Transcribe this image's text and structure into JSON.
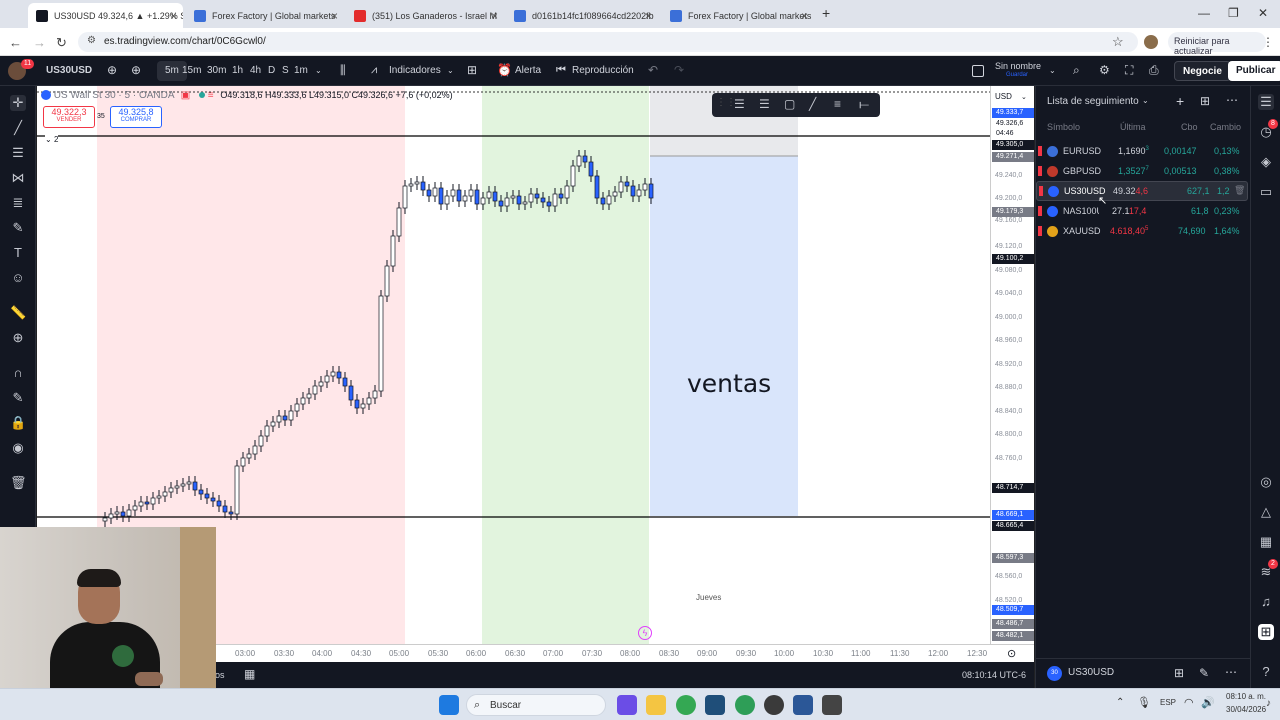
{
  "browser": {
    "tabs": [
      {
        "title": "US30USD 49.324,6 ▲ +1.29% S",
        "active": true,
        "fav_color": "#131722"
      },
      {
        "title": "Forex Factory | Global markets",
        "active": false,
        "fav_color": "#3b6fd8"
      },
      {
        "title": "(351) Los Ganaderos - Israel M",
        "active": false,
        "fav_color": "#e32c2c"
      },
      {
        "title": "d0161b14fc1f089664cd2202fb",
        "active": false,
        "fav_color": "#3b6fd8"
      },
      {
        "title": "Forex Factory | Global markets",
        "active": false,
        "fav_color": "#3b6fd8"
      }
    ],
    "new_tab": "+",
    "url": "es.tradingview.com/chart/0C6Gcwl0/",
    "update_label": "Reiniciar para actualizar"
  },
  "toolbar": {
    "notif_count": "11",
    "symbol": "US30USD",
    "timeframes": [
      "5m",
      "15m",
      "30m",
      "1h",
      "4h",
      "D",
      "S",
      "1m"
    ],
    "indicators_label": "Indicadores",
    "alert_label": "Alerta",
    "replay_label": "Reproducción",
    "layout_name": "Sin nombre",
    "layout_sub": "Guardar",
    "trade_label": "Negocie",
    "publish_label": "Publicar"
  },
  "legend": {
    "symbol_title": "US Wall St 30 · 5 · OANDA",
    "ohlc": "O49.318,6 H49.333,6 L49.315,0 C49.326,6 +7,6 (+0,02%)",
    "sell_price": "49.322,3",
    "sell_label": "VENDER",
    "spread": "35",
    "buy_price": "49.325,8",
    "buy_label": "COMPRAR",
    "indicator_count": "2"
  },
  "chart_annotations": {
    "zone_label": "ventas",
    "day_label": "Jueves"
  },
  "price_axis": {
    "currency": "USD",
    "ticks": [
      "49.240,0",
      "49.200,0",
      "49.160,0",
      "49.120,0",
      "49.080,0",
      "49.040,0",
      "49.000,0",
      "48.960,0",
      "48.920,0",
      "48.880,0",
      "48.840,0",
      "48.800,0",
      "48.760,0",
      "48.560,0",
      "48.520,0"
    ],
    "tags": [
      {
        "text": "49.333,7",
        "color": "#2962ff"
      },
      {
        "text": "49.326,6",
        "color": "#ffffff"
      },
      {
        "text": "04:46",
        "color": "#ffffff"
      },
      {
        "text": "49.305,0",
        "color": "#131722"
      },
      {
        "text": "49.271,4",
        "color": "#787b86"
      },
      {
        "text": "49.179,3",
        "color": "#787b86"
      },
      {
        "text": "49.100,2",
        "color": "#131722"
      },
      {
        "text": "48.714,7",
        "color": "#131722"
      },
      {
        "text": "48.669,1",
        "color": "#2962ff"
      },
      {
        "text": "48.665,4",
        "color": "#131722"
      },
      {
        "text": "48.597,3",
        "color": "#787b86"
      },
      {
        "text": "48.509,7",
        "color": "#2962ff"
      },
      {
        "text": "48.486,7",
        "color": "#787b86"
      },
      {
        "text": "48.482,1",
        "color": "#787b86"
      }
    ]
  },
  "time_axis": {
    "labels": [
      "03:00",
      "03:30",
      "04:00",
      "04:30",
      "05:00",
      "05:30",
      "06:00",
      "06:30",
      "07:00",
      "07:30",
      "08:00",
      "08:30",
      "09:00",
      "09:30",
      "10:00",
      "10:30",
      "11:00",
      "11:30",
      "12:00",
      "12:30"
    ]
  },
  "bottom_bar": {
    "clock": "08:10:14 UTC-6",
    "partial_label": "los"
  },
  "watchlist": {
    "title": "Lista de seguimiento",
    "headers": {
      "symbol": "Símbolo",
      "last": "Última",
      "chg": "Cbo",
      "chgpct": "Cambio"
    },
    "rows": [
      {
        "symbol": "EURUSD",
        "last": "1,1690",
        "last_tail": "3",
        "chg": "0,00147",
        "pct": "0,13%",
        "color": "#26a69a",
        "logo": "#3b6fd8"
      },
      {
        "symbol": "GBPUSD",
        "last": "1,3527",
        "last_tail": "7",
        "chg": "0,00513",
        "pct": "0,38%",
        "color": "#26a69a",
        "logo": "#c0392b"
      },
      {
        "symbol": "US30USD",
        "last": "49.32",
        "last_tail": "4,6",
        "chg": "627,1",
        "pct": "1,2",
        "color": "#26a69a",
        "logo": "#2962ff"
      },
      {
        "symbol": "NAS100USD",
        "last": "27.1",
        "last_tail": "17,4",
        "chg": "61,8",
        "pct": "0,23%",
        "color": "#26a69a",
        "logo": "#2962ff"
      },
      {
        "symbol": "XAUUSD",
        "last": "4.618,40",
        "last_tail": "5",
        "chg": "74,690",
        "pct": "1,64%",
        "color": "#26a69a",
        "logo": "#e3a21a"
      }
    ],
    "footer_symbol": "US30USD",
    "footer_logo": "30"
  },
  "right_badges": {
    "top": "8",
    "mid": "2"
  },
  "taskbar": {
    "search_label": "Buscar",
    "lang": "ESP",
    "time": "08:10 a. m.",
    "date": "30/04/2026"
  }
}
